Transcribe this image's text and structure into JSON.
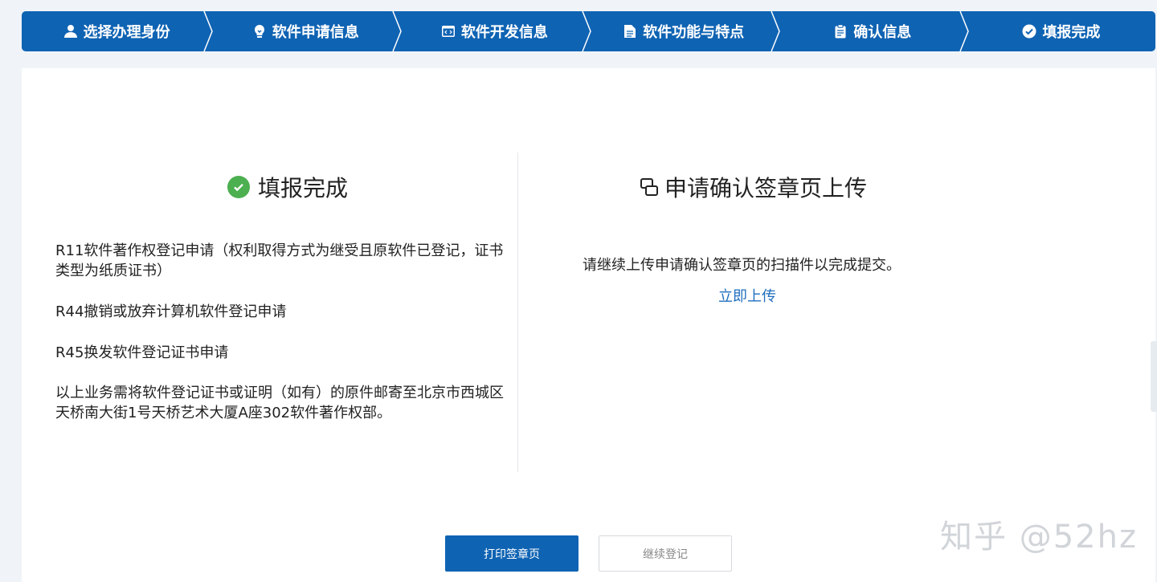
{
  "steps": [
    {
      "label": "选择办理身份",
      "icon": "user-icon"
    },
    {
      "label": "软件申请信息",
      "icon": "bulb-icon"
    },
    {
      "label": "软件开发信息",
      "icon": "code-window-icon"
    },
    {
      "label": "软件功能与特点",
      "icon": "document-icon"
    },
    {
      "label": "确认信息",
      "icon": "clipboard-icon"
    },
    {
      "label": "填报完成",
      "icon": "check-circle-icon"
    }
  ],
  "left": {
    "title": "填报完成",
    "paragraphs": [
      "R11软件著作权登记申请（权利取得方式为继受且原软件已登记，证书类型为纸质证书）",
      "R44撤销或放弃计算机软件登记申请",
      "R45换发软件登记证书申请",
      "以上业务需将软件登记证书或证明（如有）的原件邮寄至北京市西城区天桥南大街1号天桥艺术大厦A座302软件著作权部。"
    ]
  },
  "right": {
    "title": "申请确认签章页上传",
    "description": "请继续上传申请确认签章页的扫描件以完成提交。",
    "upload_link": "立即上传"
  },
  "buttons": {
    "print": "打印签章页",
    "continue": "继续登记"
  },
  "watermark": "知乎 @52hz",
  "colors": {
    "primary": "#0f63b3",
    "success": "#4caf50",
    "link": "#1f6fbf"
  }
}
